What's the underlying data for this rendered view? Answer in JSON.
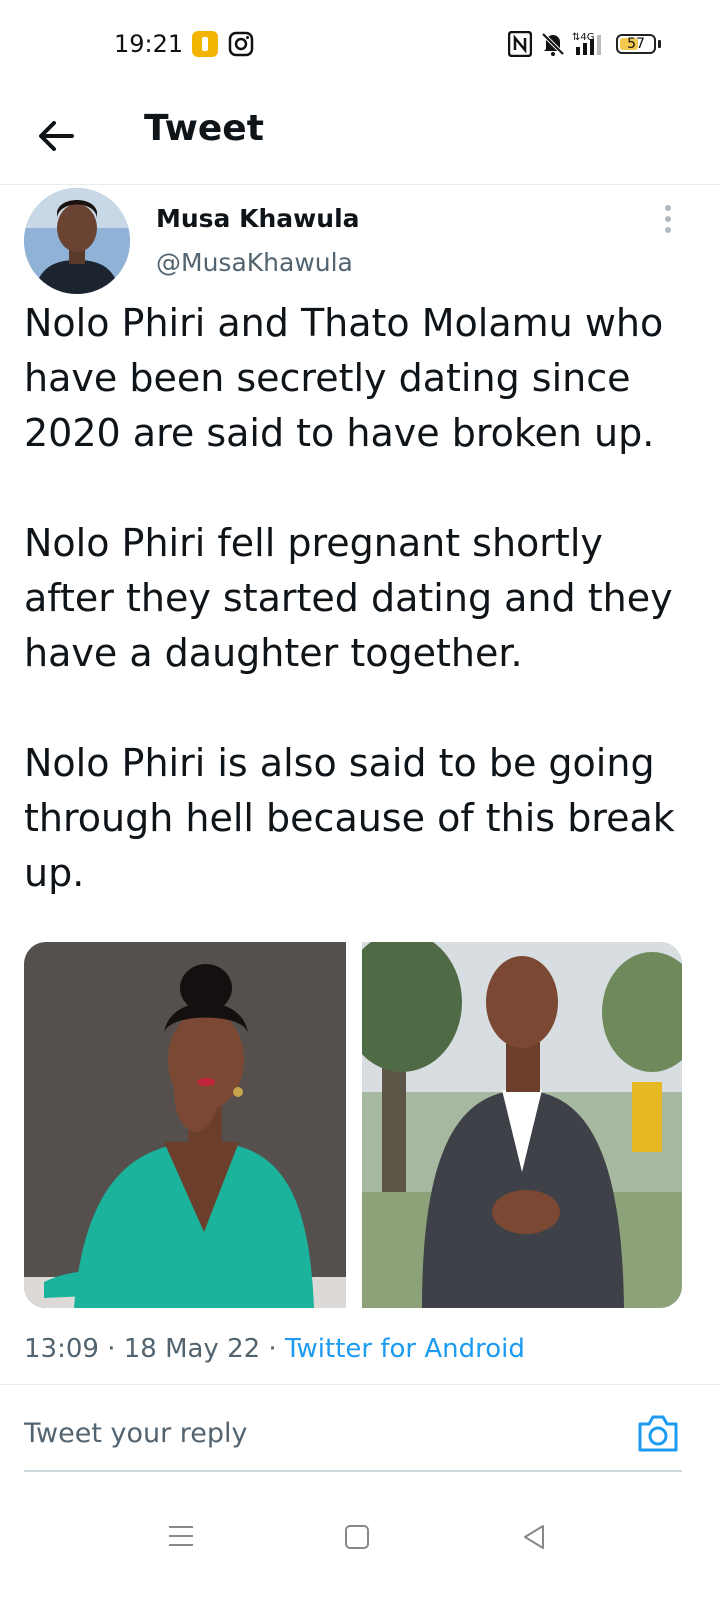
{
  "status_bar": {
    "time": "19:21",
    "network": "4G",
    "battery": "57",
    "battery_level": 0.57,
    "icons": [
      "yellow-app-icon",
      "instagram-icon",
      "nfc-icon",
      "mute-icon",
      "signal-icon",
      "battery-icon"
    ]
  },
  "header": {
    "title": "Tweet",
    "back_icon": "arrow-left-icon"
  },
  "tweet": {
    "author": {
      "display_name": "Musa Khawula",
      "handle": "@MusaKhawula"
    },
    "paragraphs": [
      "Nolo Phiri and Thato Molamu who have been secretly dating since 2020 are said to have broken up.",
      "Nolo Phiri fell pregnant shortly after they started dating and they have a daughter together.",
      "Nolo Phiri is also said to be going through hell because of this break up."
    ],
    "timestamp": "13:09 · 18 May 22 · ",
    "source": "Twitter for Android"
  },
  "reply": {
    "placeholder": "Tweet your reply",
    "camera_icon": "camera-icon"
  },
  "colors": {
    "accent": "#1d9bf0",
    "text": "#0f1419",
    "muted": "#536471",
    "divider": "#e6ecf0"
  },
  "navbar": {
    "icons": [
      "menu-icon",
      "home-square-icon",
      "back-triangle-icon"
    ]
  }
}
